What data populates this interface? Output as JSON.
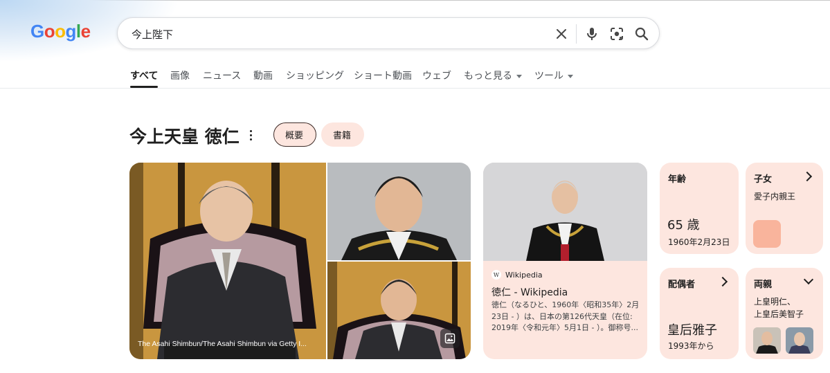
{
  "search": {
    "query": "今上陛下"
  },
  "logo": {
    "text": "Google"
  },
  "tabs": [
    {
      "label": "すべて"
    },
    {
      "label": "画像"
    },
    {
      "label": "ニュース"
    },
    {
      "label": "動画"
    },
    {
      "label": "ショッピング"
    },
    {
      "label": "ショート動画"
    },
    {
      "label": "ウェブ"
    },
    {
      "label": "もっと見る"
    },
    {
      "label": "ツール"
    }
  ],
  "entity": {
    "title": "今上天皇 徳仁",
    "chips": [
      "概要",
      "書籍"
    ]
  },
  "photos": {
    "credit": "The Asahi Shimbun/The Asahi Shimbun via Getty I..."
  },
  "wiki": {
    "source": "Wikipedia",
    "title": "徳仁 - Wikipedia",
    "snippet": "徳仁（なるひと、1960年〈昭和35年〉2月23日 - ）は、日本の第126代天皇（在位: 2019年〈令和元年〉5月1日 - ）。御称号..."
  },
  "cards": {
    "age": {
      "label": "年齢",
      "value": "65 歳",
      "sub": "1960年2月23日"
    },
    "children": {
      "label": "子女",
      "value": "愛子内親王"
    },
    "spouse": {
      "label": "配偶者",
      "value": "皇后雅子",
      "sub": "1993年から"
    },
    "parents": {
      "label": "両親",
      "line1": "上皇明仁、",
      "line2": "上皇后美智子"
    }
  },
  "colors": {
    "card_bg": "#fde6df",
    "accent": "#1a73e8"
  }
}
